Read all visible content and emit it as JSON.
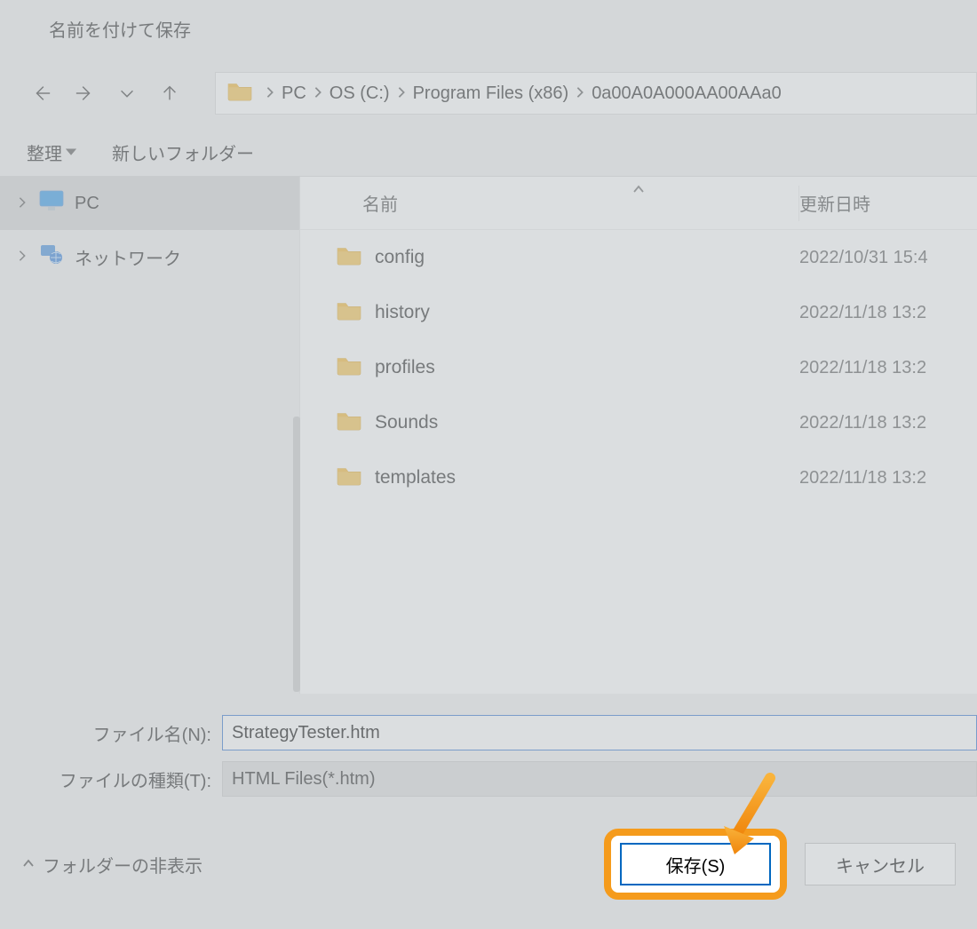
{
  "title": "名前を付けて保存",
  "breadcrumbs": [
    "PC",
    "OS (C:)",
    "Program Files (x86)",
    "0a00A0A000AA00AAa0"
  ],
  "toolbar": {
    "organize": "整理",
    "new_folder": "新しいフォルダー"
  },
  "tree": {
    "pc": "PC",
    "network": "ネットワーク"
  },
  "columns": {
    "name": "名前",
    "date": "更新日時"
  },
  "rows": [
    {
      "name": "config",
      "date": "2022/10/31 15:4"
    },
    {
      "name": "history",
      "date": "2022/11/18 13:2"
    },
    {
      "name": "profiles",
      "date": "2022/11/18 13:2"
    },
    {
      "name": "Sounds",
      "date": "2022/11/18 13:2"
    },
    {
      "name": "templates",
      "date": "2022/11/18 13:2"
    }
  ],
  "form": {
    "filename_label": "ファイル名(N):",
    "filename_value": "StrategyTester.htm",
    "filetype_label": "ファイルの種類(T):",
    "filetype_value": "HTML Files(*.htm)"
  },
  "footer": {
    "hide_folders": "フォルダーの非表示",
    "save": "保存(S)",
    "cancel": "キャンセル"
  }
}
